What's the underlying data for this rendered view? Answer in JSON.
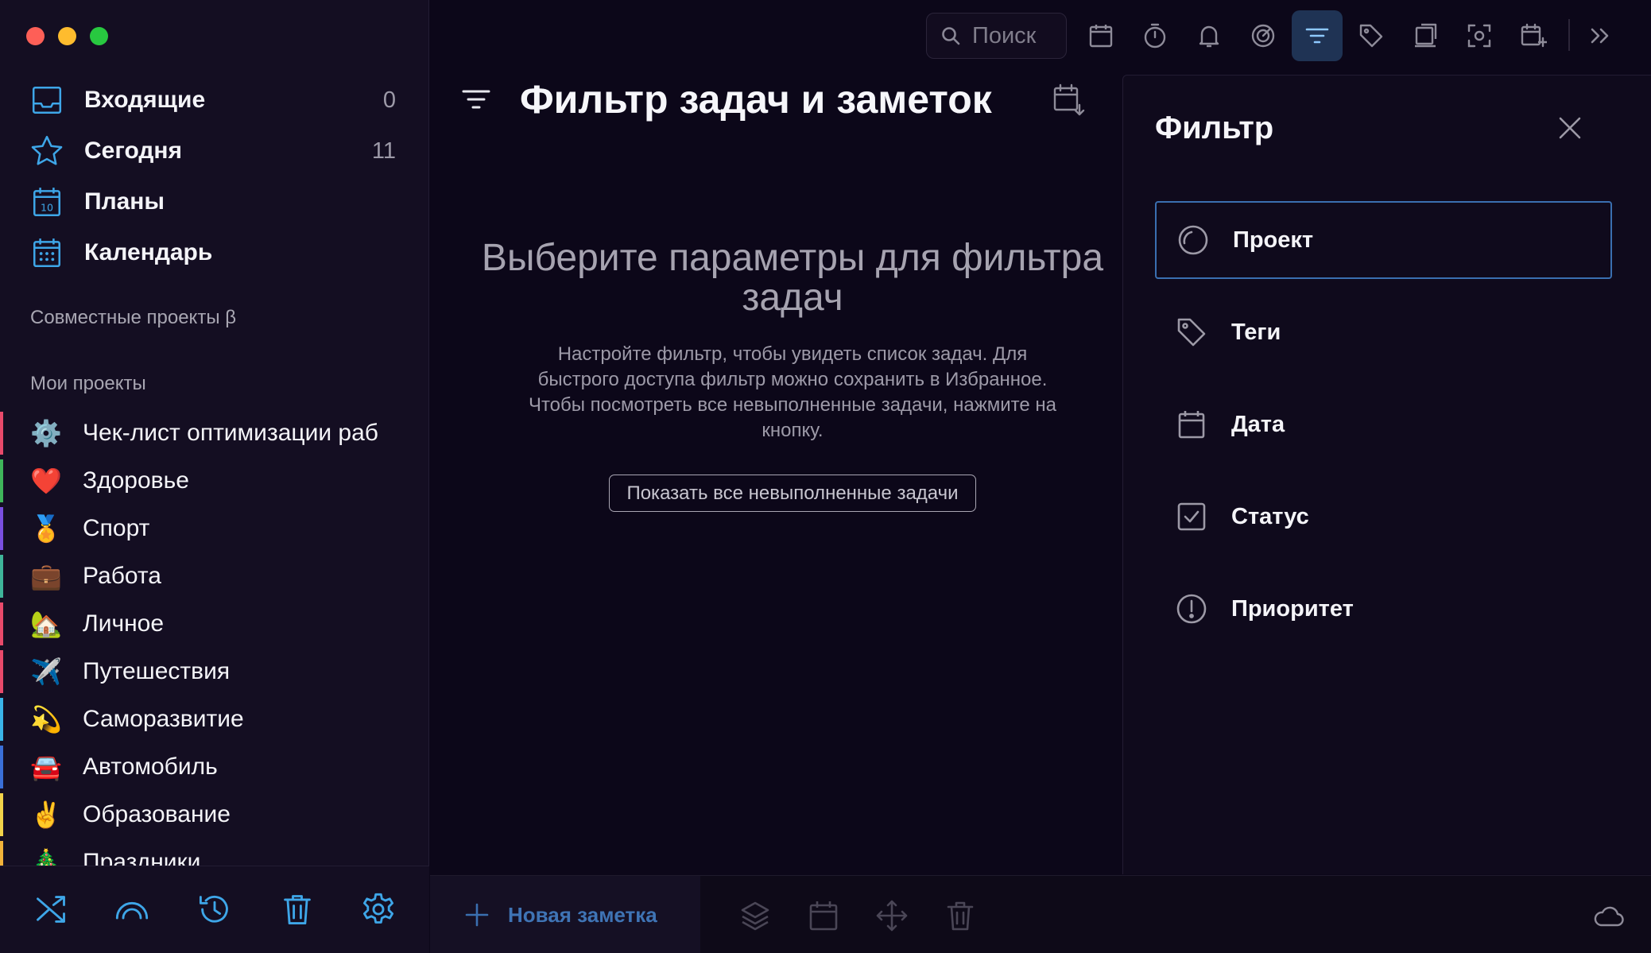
{
  "window": {
    "controls": [
      "close",
      "minimize",
      "zoom"
    ]
  },
  "sidebar": {
    "nav": [
      {
        "label": "Входящие",
        "count": "0",
        "icon": "inbox-icon"
      },
      {
        "label": "Сегодня",
        "count": "11",
        "icon": "star-icon"
      },
      {
        "label": "Планы",
        "count": "",
        "icon": "calendar-10-icon"
      },
      {
        "label": "Календарь",
        "count": "",
        "icon": "calendar-grid-icon"
      }
    ],
    "shared_title": "Совместные проекты β",
    "projects_title": "Мои проекты",
    "projects": [
      {
        "label": "Чек-лист оптимизации работы",
        "emoji": "⚙️",
        "color": "#e94a6b"
      },
      {
        "label": "Здоровье",
        "emoji": "❤️",
        "color": "#3fb55a"
      },
      {
        "label": "Спорт",
        "emoji": "🏅",
        "color": "#7a4fe0"
      },
      {
        "label": "Работа",
        "emoji": "💼",
        "color": "#3fb59a"
      },
      {
        "label": "Личное",
        "emoji": "🏡",
        "color": "#e94a6b"
      },
      {
        "label": "Путешествия",
        "emoji": "✈️",
        "color": "#e94a6b"
      },
      {
        "label": "Саморазвитие",
        "emoji": "💫",
        "color": "#3ab4e8"
      },
      {
        "label": "Автомобиль",
        "emoji": "🚘",
        "color": "#3a6fd8"
      },
      {
        "label": "Образование",
        "emoji": "✌️",
        "color": "#f2d34a"
      },
      {
        "label": "Праздники",
        "emoji": "🎄",
        "color": "#f2b33a"
      }
    ],
    "bottom_icons": [
      "shuffle-icon",
      "rainbow-icon",
      "history-icon",
      "trash-icon",
      "settings-icon"
    ]
  },
  "toolbar": {
    "search_placeholder": "Поиск",
    "icons": [
      "calendar-icon",
      "timer-icon",
      "bell-icon",
      "chart-icon",
      "filter-icon",
      "tag-icon",
      "note-icon",
      "focus-icon",
      "add-calendar-icon",
      "chevron-double-right-icon"
    ],
    "active": "filter-icon"
  },
  "main": {
    "title": "Фильтр задач и заметок",
    "empty_title": "Выберите параметры для фильтра задач",
    "empty_text": "Настройте фильтр, чтобы увидеть список задач. Для быстрого доступа фильтр можно сохранить в Избранное. Чтобы посмотреть все невыполненные задачи, нажмите на кнопку.",
    "show_all_button": "Показать все невыполненные задачи"
  },
  "filter_panel": {
    "title": "Фильтр",
    "items": [
      {
        "label": "Проект",
        "icon": "project-circle-icon",
        "selected": true
      },
      {
        "label": "Теги",
        "icon": "tag-icon",
        "selected": false
      },
      {
        "label": "Дата",
        "icon": "calendar-icon",
        "selected": false
      },
      {
        "label": "Статус",
        "icon": "checkbox-icon",
        "selected": false
      },
      {
        "label": "Приоритет",
        "icon": "priority-icon",
        "selected": false
      }
    ]
  },
  "bottom_bar": {
    "new_note_label": "Новая заметка",
    "icons": [
      "layers-icon",
      "calendar-icon",
      "move-icon",
      "trash-icon",
      "cloud-icon"
    ]
  }
}
